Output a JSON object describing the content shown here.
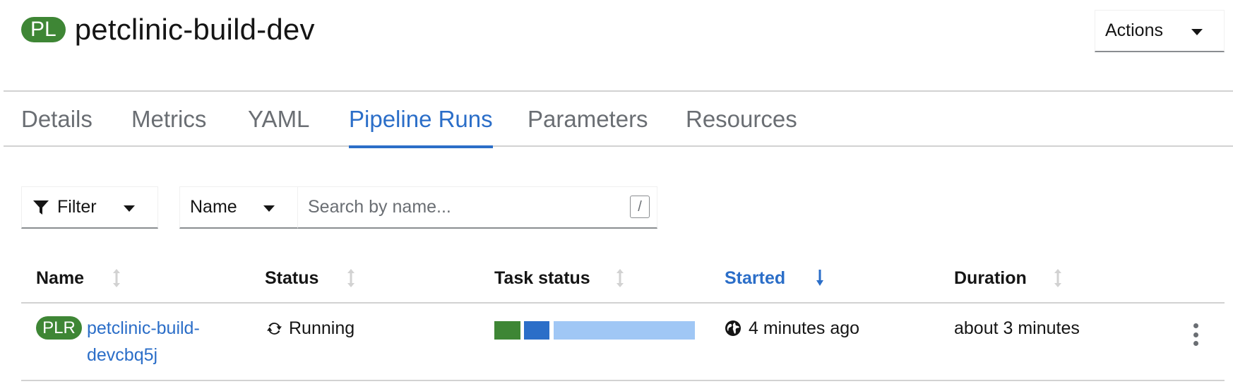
{
  "header": {
    "badge": "PL",
    "title": "petclinic-build-dev",
    "actions_label": "Actions"
  },
  "tabs": [
    {
      "label": "Details",
      "active": false
    },
    {
      "label": "Metrics",
      "active": false
    },
    {
      "label": "YAML",
      "active": false
    },
    {
      "label": "Pipeline Runs",
      "active": true
    },
    {
      "label": "Parameters",
      "active": false
    },
    {
      "label": "Resources",
      "active": false
    }
  ],
  "toolbar": {
    "filter_label": "Filter",
    "name_select": "Name",
    "search_placeholder": "Search by name...",
    "search_value": "",
    "search_hint": "/"
  },
  "table": {
    "columns": [
      "Name",
      "Status",
      "Task status",
      "Started",
      "Duration"
    ],
    "sorted_column": "Started",
    "rows": [
      {
        "badge": "PLR",
        "name_line1": "petclinic-build-",
        "name_line2": "devcbq5j",
        "status": "Running",
        "task_segments": [
          {
            "state": "succeeded",
            "color": "#3e8635"
          },
          {
            "state": "running",
            "color": "#2b6ec8"
          },
          {
            "state": "pending",
            "color": "#a0c7f5"
          }
        ],
        "started": "4 minutes ago",
        "duration": "about 3 minutes"
      }
    ]
  },
  "colors": {
    "accent": "#2b6ec8",
    "success": "#3e8635",
    "pending": "#a0c7f5"
  },
  "icons": [
    "caret-down-icon",
    "filter-icon",
    "sort-icon",
    "sort-desc-icon",
    "sync-icon",
    "globe-icon",
    "kebab-icon"
  ]
}
